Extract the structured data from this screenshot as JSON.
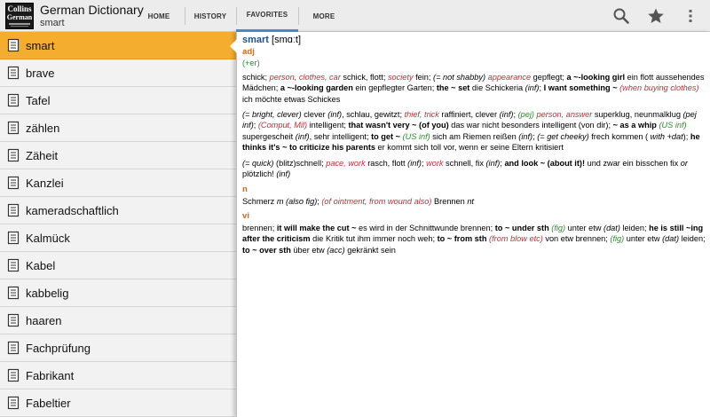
{
  "app": {
    "logo_line1": "Collins",
    "logo_line2": "German",
    "title": "German Dictionary",
    "subtitle": "smart"
  },
  "tabs": [
    {
      "label": "HOME",
      "active": false
    },
    {
      "label": "HISTORY",
      "active": false
    },
    {
      "label": "FAVORITES",
      "active": true
    },
    {
      "label": "MORE",
      "active": false
    }
  ],
  "actions": {
    "search": "search-icon",
    "favorite": "star-icon",
    "overflow": "overflow-menu-icon"
  },
  "colors": {
    "accent": "#4f8ed0",
    "selected": "#f4ad2f",
    "headword": "#1d4f91",
    "pos": "#d5691a",
    "context": "#c1303a",
    "label": "#2e8b2e"
  },
  "sidebar": {
    "items": [
      {
        "label": "smart",
        "selected": true
      },
      {
        "label": "brave"
      },
      {
        "label": "Tafel"
      },
      {
        "label": "zählen"
      },
      {
        "label": "Zäheit"
      },
      {
        "label": "Kanzlei"
      },
      {
        "label": "kameradschaftlich"
      },
      {
        "label": "Kalmück"
      },
      {
        "label": "Kabel"
      },
      {
        "label": "kabbelig"
      },
      {
        "label": "haaren"
      },
      {
        "label": "Fachprüfung"
      },
      {
        "label": "Fabrikant"
      },
      {
        "label": "Fabeltier"
      }
    ]
  },
  "entry": {
    "headword": "smart",
    "phonetic": "[smɑːt]",
    "adj": {
      "pos": "adj",
      "grammar": "(+er)",
      "p1": {
        "a": "schick; ",
        "b": "person, clothes, car",
        "c": " schick, flott; ",
        "d": "society",
        "e": " fein; ",
        "f": "(= not shabby)",
        "g": " ",
        "h": "appearance",
        "i": " gepflegt; ",
        "j": "a ~-looking girl",
        "k": " ein flott aussehendes Mädchen; ",
        "l": "a ~-looking garden",
        "m": " ein gepflegter Garten; ",
        "n": "the ~ set",
        "o": " die Schickeria ",
        "p": "(inf)",
        "q": "; ",
        "r": "I want something ~",
        "s": " ",
        "t": "(when buying clothes)",
        "u": " ich möchte etwas Schickes"
      },
      "p2": {
        "a": "(= bright, clever)",
        "b": " clever ",
        "c": "(inf)",
        "d": ", schlau, gewitzt; ",
        "e": "thief, trick",
        "f": " raffiniert, clever ",
        "g": "(inf)",
        "h": "; ",
        "i": "(pej)",
        "j": " ",
        "k": "person, answer",
        "l": " superklug, neunmalklug ",
        "m": "(pej inf)",
        "n": "; ",
        "o": "(Comput, Mil)",
        "p": " intelligent; ",
        "q": "that wasn't very ~ (of you)",
        "r": " das war nicht besonders intelligent (von dir); ",
        "s": "~ as a whip",
        "t": " ",
        "u": "(US inf)",
        "v": " supergescheit ",
        "w": "(inf)",
        "x": ", sehr intelligent; ",
        "y": "to get ~",
        "z": " ",
        "aa": "(US inf)",
        "ab": " sich am Riemen reißen ",
        "ac": "(inf)",
        "ad": "; ",
        "ae": "(= get cheeky)",
        "af": " frech kommen ( ",
        "ag": "with +dat",
        "ah": "); ",
        "ai": "he thinks it's ~ to criticize his parents",
        "aj": " er kommt sich toll vor, wenn er seine Eltern kritisiert"
      },
      "p3": {
        "a": "(= quick)",
        "b": " (blitz)schnell; ",
        "c": "pace, work",
        "d": " rasch, flott ",
        "e": "(inf)",
        "f": "; ",
        "g": "work",
        "h": " schnell, fix ",
        "i": "(inf)",
        "j": "; ",
        "k": "and look ~ (about it)!",
        "l": " und zwar ein bisschen fix ",
        "m": "or",
        "n": " plötzlich! ",
        "o": "(inf)"
      }
    },
    "noun": {
      "pos": "n",
      "a": "Schmerz ",
      "b": "m",
      "c": " ",
      "d": "(also fig)",
      "e": "; ",
      "f": "(of ointment, from wound also)",
      "g": " Brennen ",
      "h": "nt"
    },
    "verb": {
      "pos": "vi",
      "a": "brennen; ",
      "b": "it will make the cut ~",
      "c": " es wird in der Schnittwunde brennen; ",
      "d": "to ~ under sth",
      "e": " ",
      "f": "(fig)",
      "g": " unter etw ",
      "h": "(dat)",
      "i": " leiden; ",
      "j": "he is still ~ing after the criticism",
      "k": " die Kritik tut ihm immer noch weh; ",
      "l": "to ~ from sth",
      "m": " ",
      "n": "(from blow etc)",
      "o": " von etw brennen; ",
      "p": "(fig)",
      "q": " unter etw ",
      "r": "(dat)",
      "s": " leiden; ",
      "t": "to ~ over sth",
      "u": " über etw ",
      "v": "(acc)",
      "w": " gekränkt sein"
    }
  }
}
